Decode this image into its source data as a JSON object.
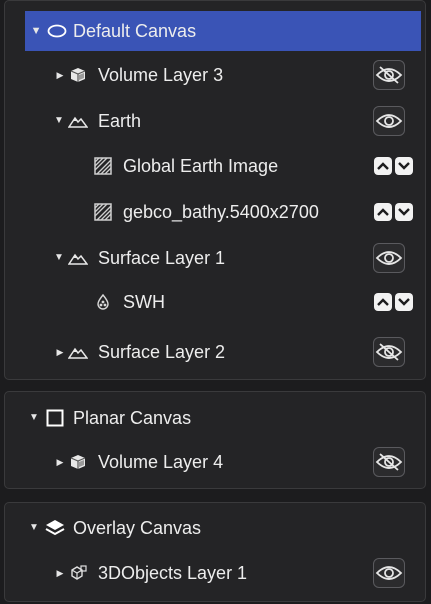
{
  "canvases": [
    {
      "title": "Default Canvas",
      "icon": "ellipse-icon",
      "layers": [
        {
          "label": "Volume Layer 3",
          "icon": "cube-icon",
          "visible": false,
          "expanded": false
        },
        {
          "label": "Earth",
          "icon": "mountain-icon",
          "visible": true,
          "expanded": true,
          "children": [
            {
              "label": "Global Earth Image",
              "icon": "texture-icon"
            },
            {
              "label": "gebco_bathy.5400x2700",
              "icon": "texture-icon"
            }
          ]
        },
        {
          "label": "Surface Layer 1",
          "icon": "mountain-icon",
          "visible": true,
          "expanded": true,
          "children": [
            {
              "label": "SWH",
              "icon": "dropset-icon"
            }
          ]
        },
        {
          "label": "Surface Layer 2",
          "icon": "mountain-icon",
          "visible": false,
          "expanded": false
        }
      ]
    },
    {
      "title": "Planar Canvas",
      "icon": "square-icon",
      "layers": [
        {
          "label": "Volume Layer 4",
          "icon": "cube-icon",
          "visible": false,
          "expanded": false
        }
      ]
    },
    {
      "title": "Overlay Canvas",
      "icon": "stack-icon",
      "layers": [
        {
          "label": "3DObjects Layer 1",
          "icon": "objects-icon",
          "visible": true,
          "expanded": false
        }
      ]
    }
  ],
  "colors": {
    "selection": "#3a54b6",
    "panel": "#242426",
    "background": "#1c1c1e"
  }
}
